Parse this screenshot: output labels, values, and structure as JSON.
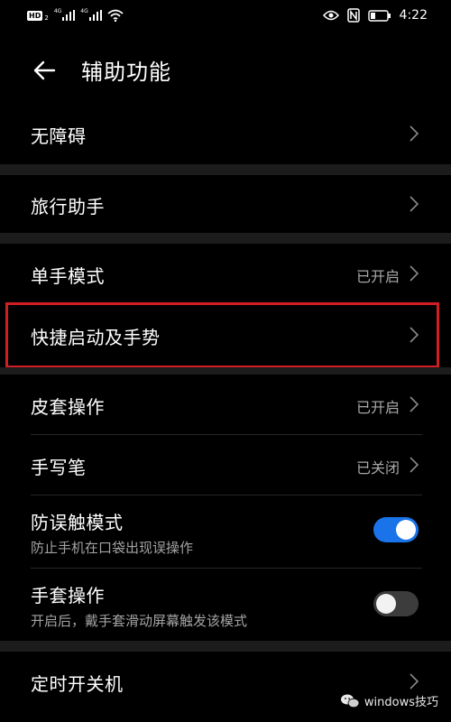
{
  "status_bar": {
    "hd_label": "HD",
    "hd_sub": "2",
    "net1": "4G",
    "net2": "4G",
    "time": "4:22"
  },
  "header": {
    "title": "辅助功能"
  },
  "items": [
    {
      "title": "无障碍",
      "status": ""
    },
    {
      "title": "旅行助手",
      "status": ""
    },
    {
      "title": "单手模式",
      "status": "已开启"
    },
    {
      "title": "快捷启动及手势",
      "status": ""
    },
    {
      "title": "皮套操作",
      "status": "已开启"
    },
    {
      "title": "手写笔",
      "status": "已关闭"
    },
    {
      "title": "防误触模式",
      "subtitle": "防止手机在口袋出现误操作",
      "toggle_on": true
    },
    {
      "title": "手套操作",
      "subtitle": "开启后，戴手套滑动屏幕触发该模式",
      "toggle_on": false
    },
    {
      "title": "定时开关机",
      "status": ""
    }
  ],
  "watermark": {
    "text": "windows技巧"
  },
  "colors": {
    "background": "#000000",
    "section_band": "#1c1c1c",
    "toggle_on": "#1a73e8",
    "toggle_off": "#3c3c3c",
    "highlight_box": "#d01e24",
    "secondary_text": "#a8a8a8"
  },
  "icons": [
    "back-arrow-icon",
    "chevron-right-icon",
    "wifi-icon",
    "signal-icon",
    "eye-icon",
    "nfc-icon",
    "battery-icon",
    "wechat-icon"
  ]
}
